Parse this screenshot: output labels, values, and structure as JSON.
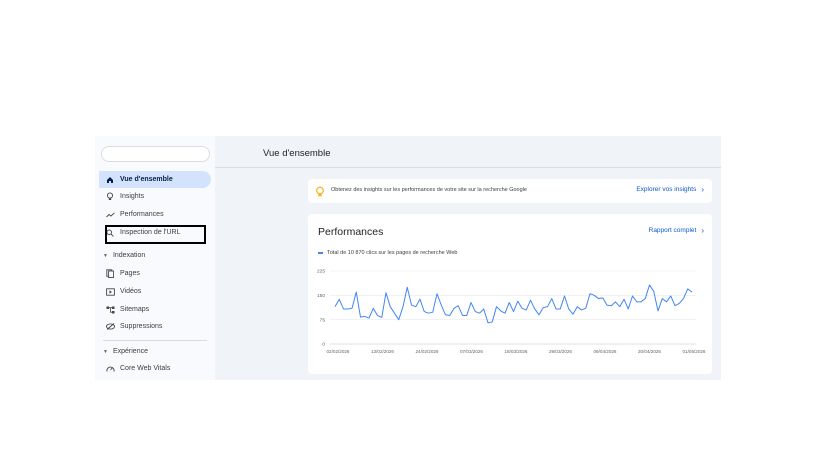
{
  "sidebar": {
    "search_placeholder": "",
    "items": [
      {
        "label": "Vue d'ensemble",
        "icon": "home-icon",
        "active": true
      },
      {
        "label": "Insights",
        "icon": "lightbulb-icon"
      },
      {
        "label": "Performances",
        "icon": "trending-icon"
      },
      {
        "label": "Inspection de l'URL",
        "icon": "search-icon"
      }
    ],
    "indexation": {
      "header": "Indexation",
      "items": [
        {
          "label": "Pages",
          "icon": "pages-icon"
        },
        {
          "label": "Vidéos",
          "icon": "video-icon"
        },
        {
          "label": "Sitemaps",
          "icon": "sitemap-icon"
        },
        {
          "label": "Suppressions",
          "icon": "removals-icon"
        }
      ]
    },
    "experience": {
      "header": "Expérience",
      "items": [
        {
          "label": "Core Web Vitals",
          "icon": "gauge-icon"
        }
      ]
    }
  },
  "main": {
    "title": "Vue d'ensemble",
    "banner": {
      "text": "Obtenez des insights sur les performances de votre site sur la recherche Google",
      "link": "Explorer vos insights",
      "icon": "lightbulb-icon"
    },
    "performance": {
      "title": "Performances",
      "link": "Rapport complet",
      "legend": "Total de 10 870 clics sur les pages de recherche Web"
    }
  },
  "colors": {
    "accent": "#0b57d0",
    "line": "#4285f4",
    "active_nav": "#d3e3fd",
    "bulb": "#f9ab00"
  },
  "chart_data": {
    "type": "line",
    "yticks": [
      "225",
      "150",
      "75",
      "0"
    ],
    "ylim": [
      0,
      225
    ],
    "xticks": [
      "02/02/2026",
      "13/02/2026",
      "24/02/2026",
      "07/03/2026",
      "18/03/2026",
      "29/03/2026",
      "09/04/2026",
      "20/04/2026",
      "01/05/2026"
    ],
    "series": [
      {
        "name": "Clics",
        "values": [
          115,
          138,
          108,
          108,
          110,
          160,
          83,
          85,
          80,
          110,
          88,
          82,
          158,
          115,
          95,
          75,
          115,
          175,
          120,
          115,
          138,
          100,
          95,
          98,
          155,
          120,
          90,
          88,
          110,
          118,
          88,
          88,
          128,
          100,
          95,
          108,
          65,
          68,
          115,
          102,
          95,
          128,
          100,
          132,
          110,
          105,
          135,
          108,
          90,
          112,
          115,
          140,
          108,
          108,
          148,
          108,
          92,
          115,
          105,
          110,
          155,
          150,
          140,
          142,
          120,
          118,
          130,
          115,
          138,
          108,
          148,
          130,
          130,
          140,
          182,
          162,
          102,
          140,
          130,
          148,
          118,
          125,
          140,
          170,
          160
        ]
      }
    ]
  }
}
